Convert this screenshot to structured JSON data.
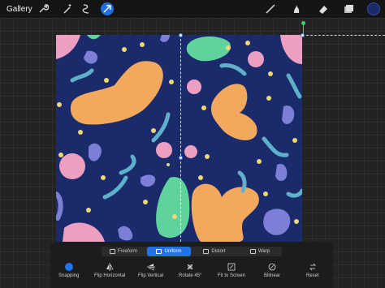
{
  "topbar": {
    "gallery_label": "Gallery",
    "tools": [
      "wrench-icon",
      "magic-wand-icon",
      "selection-icon",
      "transform-arrow-icon"
    ],
    "right_tools": [
      "brush-icon",
      "smudge-icon",
      "eraser-icon",
      "layers-icon"
    ],
    "current_color": "#1a2a6b"
  },
  "transform": {
    "modes": [
      {
        "label": "Freeform",
        "selected": false
      },
      {
        "label": "Uniform",
        "selected": true
      },
      {
        "label": "Distort",
        "selected": false
      },
      {
        "label": "Warp",
        "selected": false
      }
    ],
    "actions": [
      {
        "label": "Snapping"
      },
      {
        "label": "Flip Horizontal"
      },
      {
        "label": "Flip Vertical"
      },
      {
        "label": "Rotate 45°"
      },
      {
        "label": "Fit to Screen"
      },
      {
        "label": "Bilinear"
      },
      {
        "label": "Reset"
      }
    ]
  },
  "colors": {
    "accent": "#1f72e8",
    "canvas_bg": "#1a2a6b",
    "orange": "#f2a95e",
    "green": "#5fd39b",
    "pink": "#ec9fc1",
    "purple": "#7b7fd6",
    "teal": "#5fb0c9",
    "yellow": "#e9d877"
  }
}
